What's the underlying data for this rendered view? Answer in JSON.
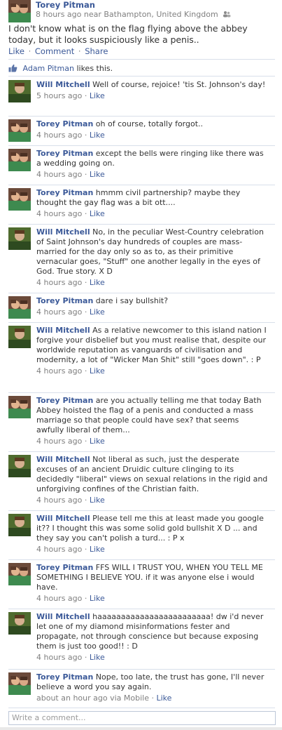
{
  "post": {
    "author": "Torey Pitman",
    "meta": "8 hours ago near Bathampton, United Kingdom",
    "status": "I don't know what is on the flag flying above the abbey today, but it looks suspiciously like a penis..",
    "actions": {
      "like": "Like",
      "comment": "Comment",
      "share": "Share"
    },
    "likes": {
      "name": "Adam Pitman",
      "suffix": "likes this."
    }
  },
  "comments": [
    {
      "author": "Will Mitchell",
      "text": "Well of course, rejoice! 'tis St. Johnson's day!",
      "time": "5 hours ago",
      "like": "Like"
    },
    {
      "author": "Torey Pitman",
      "text": "oh of course, totally forgot..",
      "time": "4 hours ago",
      "like": "Like"
    },
    {
      "author": "Torey Pitman",
      "text": "except the bells were ringing like there was a wedding going on.",
      "time": "4 hours ago",
      "like": "Like"
    },
    {
      "author": "Torey Pitman",
      "text": "hmmm civil partnership? maybe they thought the gay flag was a bit ott....",
      "time": "4 hours ago",
      "like": "Like"
    },
    {
      "author": "Will Mitchell",
      "text": "No, in the peculiar West-Country celebration of Saint Johnson's day hundreds of couples are mass-married for the day only so as to, as their primitive vernacular goes, \"Stuff\" one another legally in the eyes of God. True story. X D",
      "time": "4 hours ago",
      "like": "Like"
    },
    {
      "author": "Torey Pitman",
      "text": "dare i say bullshit?",
      "time": "4 hours ago",
      "like": "Like"
    },
    {
      "author": "Will Mitchell",
      "text": "As a relative newcomer to this island nation I forgive your disbelief but you must realise that, despite our worldwide reputation as vanguards of civilisation and modernity, a lot of \"Wicker Man Shit\" still \"goes down\". : P",
      "time": "4 hours ago",
      "like": "Like"
    },
    {
      "author": "Torey Pitman",
      "text": "are you actually telling me that today Bath Abbey hoisted the flag of a penis and conducted a mass marriage so that people could have sex? that seems awfully liberal of them...",
      "time": "4 hours ago",
      "like": "Like"
    },
    {
      "author": "Will Mitchell",
      "text": "Not liberal as such, just the desperate excuses of an ancient Druidic culture clinging to its decidedly \"liberal\" views on sexual relations in the rigid and unforgiving confines of the Christian faith.",
      "time": "4 hours ago",
      "like": "Like"
    },
    {
      "author": "Will Mitchell",
      "text": "Please tell me this at least made you google it?? I thought this was some solid gold bullshit X D ... and they say you can't polish a turd... : P x",
      "time": "4 hours ago",
      "like": "Like"
    },
    {
      "author": "Torey Pitman",
      "text": "FFS WILL I TRUST YOU, WHEN YOU TELL ME SOMETHING I BELIEVE YOU. if it was anyone else i would have.",
      "time": "4 hours ago",
      "like": "Like"
    },
    {
      "author": "Will Mitchell",
      "text": "haaaaaaaaaaaaaaaaaaaaaaaa! dw i'd never let one of my diamond misinformations fester and propagate, not through conscience but because exposing them is just too good!! : D",
      "time": "4 hours ago",
      "like": "Like"
    },
    {
      "author": "Torey Pitman",
      "text": "Nope, too late, the trust has gone, I'll never believe a word you say again.",
      "time": "about an hour ago via Mobile",
      "like": "Like"
    }
  ],
  "write_comment": {
    "placeholder": "Write a comment..."
  },
  "colors": {
    "link": "#3b5998",
    "muted": "#7f7f7f",
    "divider": "#d8dfea"
  }
}
